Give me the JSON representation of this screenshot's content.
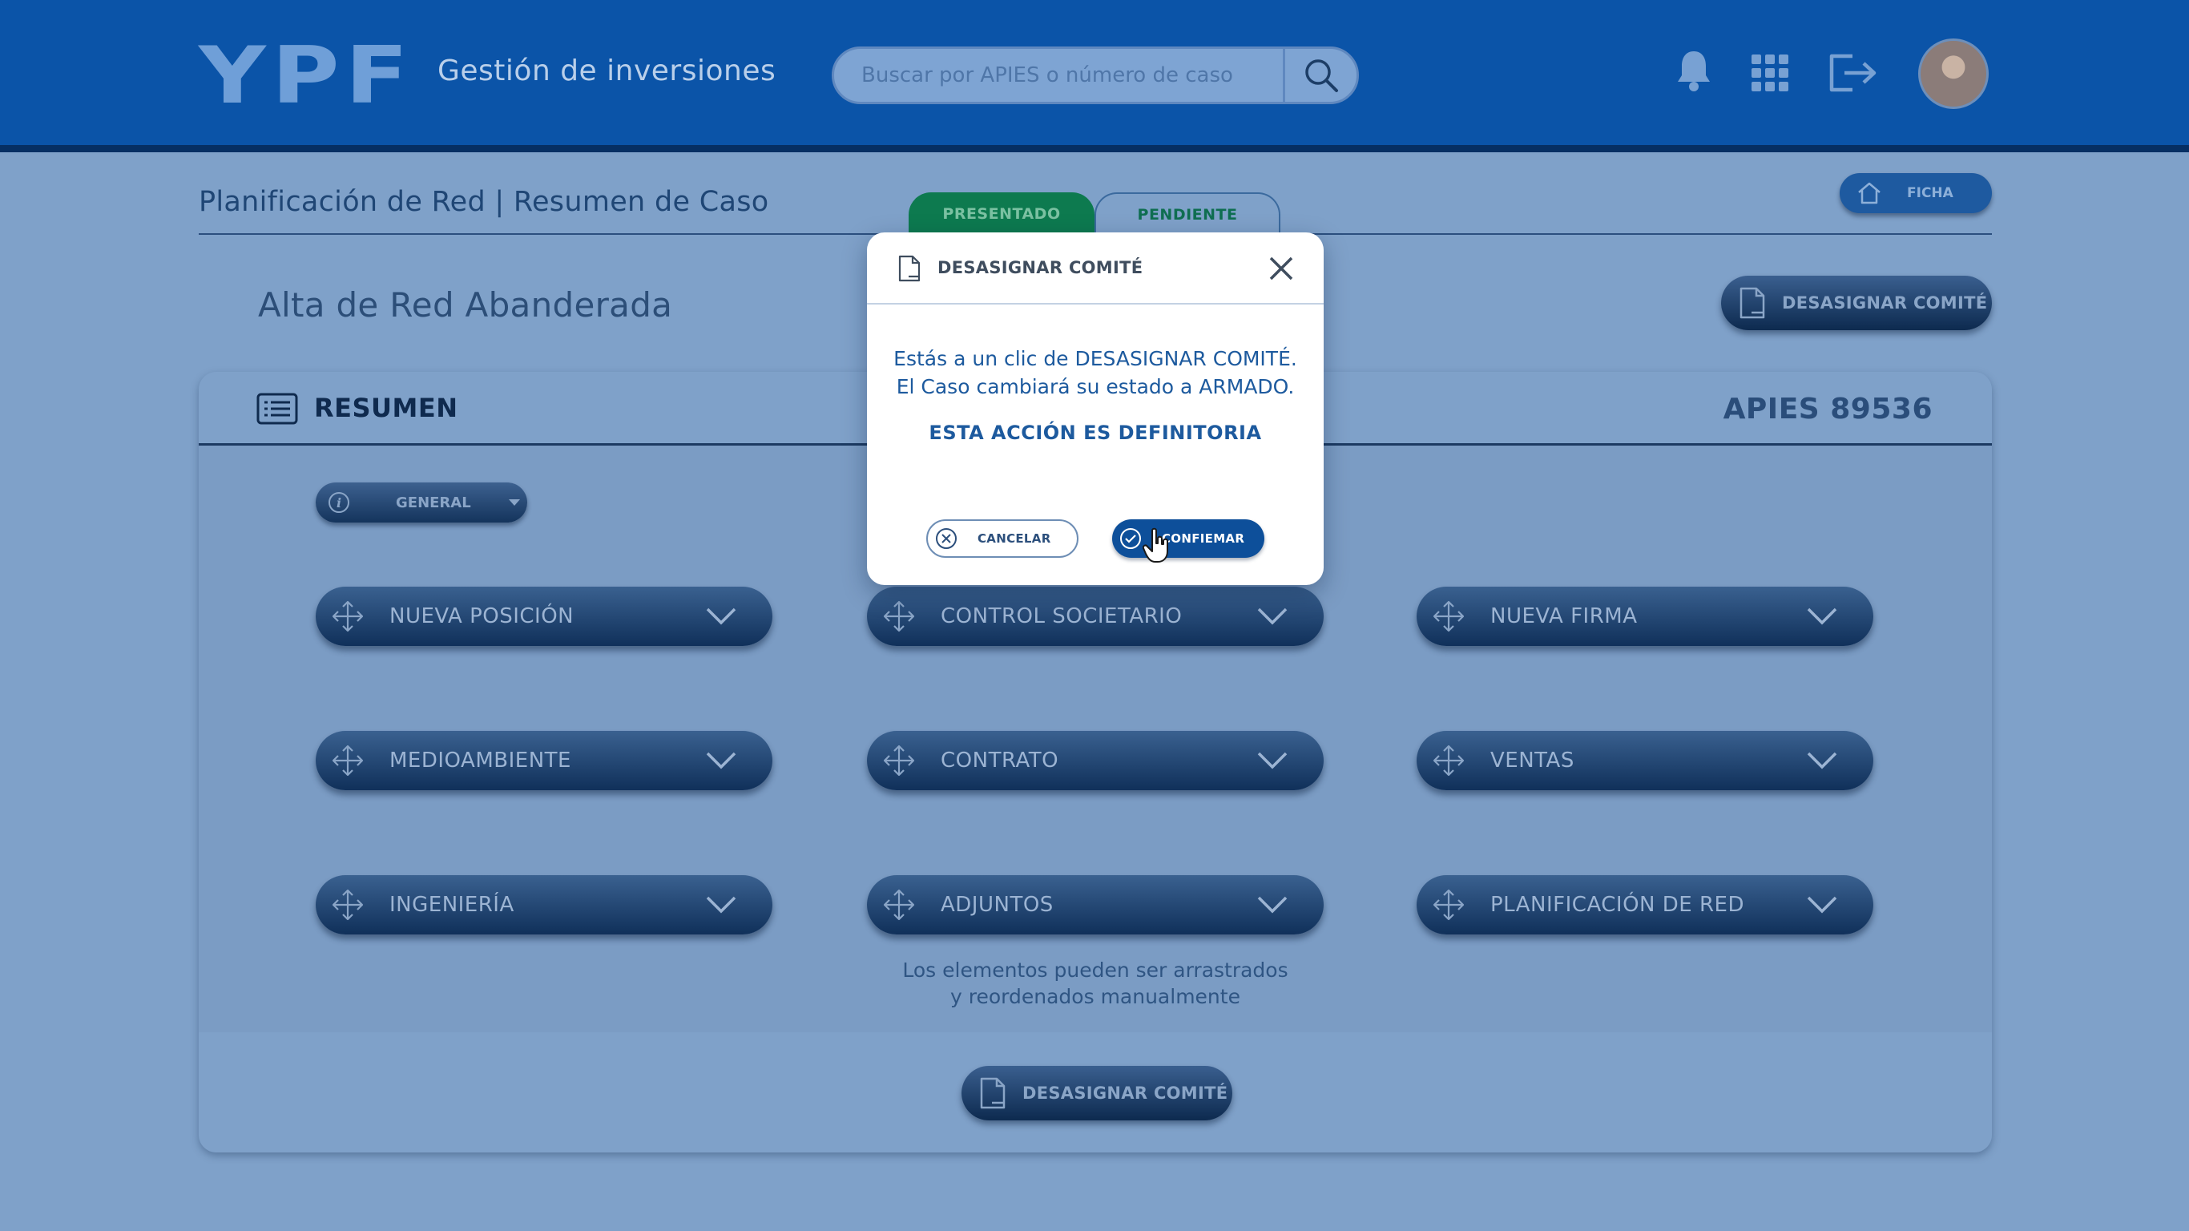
{
  "header": {
    "logo": "YPF",
    "app_title": "Gestión de inversiones",
    "search_placeholder": "Buscar por APIES o número de caso"
  },
  "page": {
    "title": "Planificación de Red | Resumen de Caso",
    "tabs": [
      {
        "label": "PRESENTADO",
        "color": "#0d7a4f"
      },
      {
        "label": "PENDIENTE",
        "color": "#0f6e51"
      }
    ],
    "ficha_label": "FICHA",
    "subtitle": "Alta de Red Abanderada",
    "unassign_label": "DESASIGNAR COMITÉ"
  },
  "summary": {
    "title": "RESUMEN",
    "apies": "APIES 89536",
    "general_label": "GENERAL",
    "sections": [
      "NUEVA POSICIÓN",
      "CONTROL SOCIETARIO",
      "NUEVA FIRMA",
      "MEDIOAMBIENTE",
      "CONTRATO",
      "VENTAS",
      "INGENIERÍA",
      "ADJUNTOS",
      "PLANIFICACIÓN DE RED"
    ],
    "hint_line1": "Los elementos pueden ser arrastrados",
    "hint_line2": "y reordenados manualmente",
    "footer_button": "DESASIGNAR COMITÉ"
  },
  "modal": {
    "title": "DESASIGNAR COMITÉ",
    "line1": "Estás a un clic de DESASIGNAR COMITÉ.",
    "line2": "El Caso cambiará su estado a ARMADO.",
    "warning": "ESTA ACCIÓN ES DEFINITORIA",
    "cancel": "CANCELAR",
    "confirm": "CONFIEMAR"
  },
  "colors": {
    "header_bg": "#0b54a8",
    "overlay": "#7fa1c9",
    "accent_green": "#0d7a4f",
    "confirm_blue": "#0d4f9a"
  }
}
